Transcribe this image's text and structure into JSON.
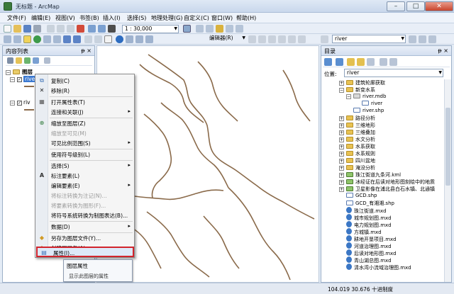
{
  "window": {
    "title": "无标题 - ArcMap",
    "min": "–",
    "max": "□",
    "close": "✕"
  },
  "menu": [
    "文件(F)",
    "编辑(E)",
    "视图(V)",
    "书签(B)",
    "插入(I)",
    "选择(S)",
    "地理处理(G)",
    "自定义(C)",
    "窗口(W)",
    "帮助(H)"
  ],
  "toolbar": {
    "scale": "1 : 30,000",
    "editor": "编辑器(R)",
    "layer": "river"
  },
  "toc": {
    "title": "内容列表",
    "pin": "ᵽ ×",
    "group": "图层",
    "layer1": "river",
    "layer2": "riv"
  },
  "context_menu": {
    "items": [
      {
        "label": "复制(C)",
        "icon": "copy-icon",
        "sym": "⧉"
      },
      {
        "label": "移除(R)",
        "icon": "remove-icon",
        "sym": "✕"
      },
      {
        "label": "打开属性表(T)",
        "icon": "table-icon",
        "sym": "▦"
      },
      {
        "label": "连接和关联(J)",
        "submenu": "▸"
      },
      {
        "label": "缩放至图层(Z)",
        "icon": "zoom-layer-icon",
        "sym": "⊕"
      },
      {
        "label": "缩放至可见(M)",
        "disabled": true
      },
      {
        "label": "可见比例范围(S)",
        "submenu": "▸"
      },
      {
        "label": "使用符号级别(L)"
      },
      {
        "label": "选择(S)",
        "submenu": "▸"
      },
      {
        "label": "标注要素(L)",
        "icon": "label-icon",
        "sym": "A"
      },
      {
        "label": "编辑要素(E)",
        "submenu": "▸"
      },
      {
        "label": "将标注转换为注记(N)...",
        "disabled": true
      },
      {
        "label": "将要素转换为图形(F)...",
        "disabled": true
      },
      {
        "label": "将符号系统转换为制图表达(B)..."
      },
      {
        "label": "数据(D)",
        "submenu": "▸"
      },
      {
        "label": "另存为图层文件(Y)...",
        "icon": "save-layer-icon",
        "sym": "◆"
      },
      {
        "label": "创建图层包(A)...",
        "icon": "package-icon",
        "sym": "◈"
      },
      {
        "label": "属性(I)...",
        "icon": "properties-icon",
        "sym": "▤"
      }
    ]
  },
  "tooltip": {
    "title": "图层属性",
    "desc": "显示此图层的属性"
  },
  "catalog": {
    "title": "目录",
    "close": "ᵽ ×",
    "location_label": "位置:",
    "location": "river",
    "items": [
      {
        "t": "建筑轮廓获取",
        "k": "folder",
        "lv": 1,
        "e": "+"
      },
      {
        "t": "新变水系",
        "k": "folder",
        "lv": 1,
        "e": "−"
      },
      {
        "t": "river.mdb",
        "k": "db",
        "lv": 2,
        "e": "−"
      },
      {
        "t": "river",
        "k": "fc",
        "lv": 3
      },
      {
        "t": "river.shp",
        "k": "shp",
        "lv": 2
      },
      {
        "t": "路径分析",
        "k": "folder",
        "lv": 1,
        "e": "+"
      },
      {
        "t": "三维地形",
        "k": "folder",
        "lv": 1,
        "e": "+"
      },
      {
        "t": "三维叠加",
        "k": "folder",
        "lv": 1,
        "e": "+"
      },
      {
        "t": "水文分析",
        "k": "folder",
        "lv": 1,
        "e": "+"
      },
      {
        "t": "水系获取",
        "k": "folder",
        "lv": 1,
        "e": "+"
      },
      {
        "t": "水系规则",
        "k": "folder",
        "lv": 1,
        "e": "+"
      },
      {
        "t": "四川盆地",
        "k": "folder",
        "lv": 1,
        "e": "+"
      },
      {
        "t": "淹没分析",
        "k": "folder",
        "lv": 1,
        "e": "+"
      },
      {
        "t": "珠江街道九条河.kml",
        "k": "kml",
        "lv": 1,
        "e": "+"
      },
      {
        "t": "冰经证在后读对地形图刻绘中的地质",
        "k": "kml",
        "lv": 1,
        "e": "+"
      },
      {
        "t": "卫星影像在浦北县白石水镇、北通镇",
        "k": "kml",
        "lv": 1,
        "e": "+"
      },
      {
        "t": "GCD.shp",
        "k": "shp",
        "lv": 1
      },
      {
        "t": "GCD_有湘湘.shp",
        "k": "shp",
        "lv": 1
      },
      {
        "t": "珠江街道.mxd",
        "k": "mxd",
        "lv": 1
      },
      {
        "t": "城市规划图.mxd",
        "k": "mxd",
        "lv": 1
      },
      {
        "t": "电力规划图.mxd",
        "k": "mxd",
        "lv": 1
      },
      {
        "t": "方城镇.mxd",
        "k": "mxd",
        "lv": 1
      },
      {
        "t": "耕地开垦项目.mxd",
        "k": "mxd",
        "lv": 1
      },
      {
        "t": "河道治理图.mxd",
        "k": "mxd",
        "lv": 1
      },
      {
        "t": "后读对地形图.mxd",
        "k": "mxd",
        "lv": 1
      },
      {
        "t": "青山湖总图.mxd",
        "k": "mxd",
        "lv": 1
      },
      {
        "t": "清水湾小流域治理图.mxd",
        "k": "mxd",
        "lv": 1
      }
    ]
  },
  "status": {
    "coords": "104.019  30.676 十进制度"
  },
  "colors": {
    "river": "#8a6a4a",
    "highlight_border": "#d2242c"
  }
}
